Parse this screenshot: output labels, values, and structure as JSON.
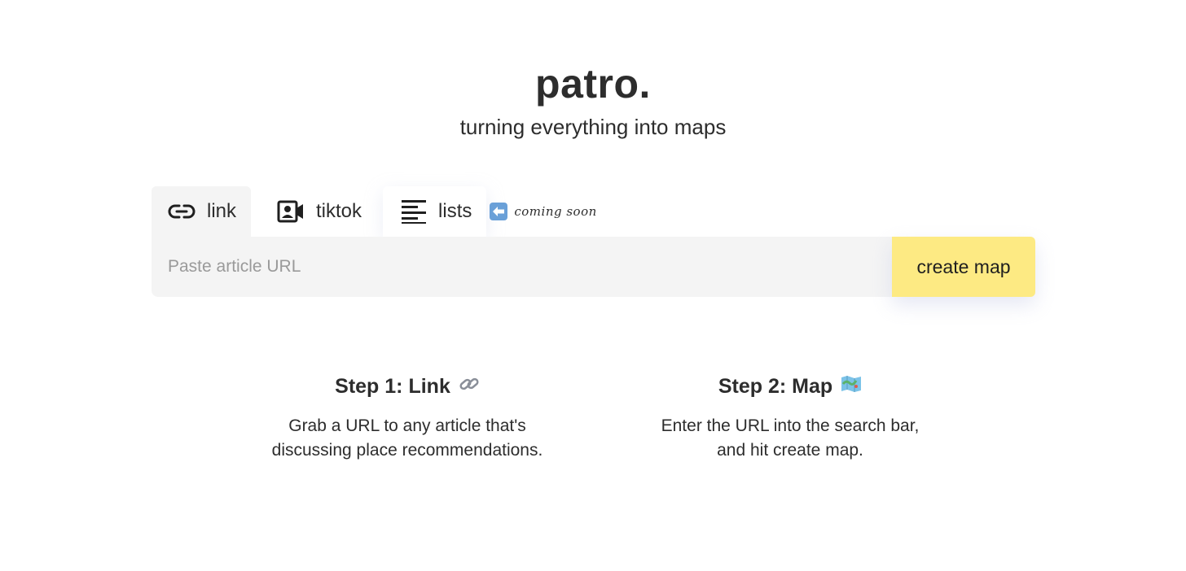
{
  "brand": {
    "logo": "patro.",
    "tagline": "turning everything into maps"
  },
  "tabs": [
    {
      "label": "link",
      "icon": "link-icon",
      "active": true
    },
    {
      "label": "tiktok",
      "icon": "contact-video-icon",
      "active": false
    },
    {
      "label": "lists",
      "icon": "list-lines-icon",
      "active": false
    }
  ],
  "coming_soon": {
    "icon": "left-arrow-icon",
    "text": "coming soon"
  },
  "search": {
    "placeholder": "Paste article URL",
    "value": "",
    "button_label": "create map"
  },
  "steps": [
    {
      "title": "Step 1: Link",
      "icon": "chain-link-icon",
      "desc_line1": "Grab a URL to any article that's",
      "desc_line2": "discussing place recommendations."
    },
    {
      "title": "Step 2: Map",
      "icon": "map-icon",
      "desc_line1": "Enter the URL into the search bar,",
      "desc_line2": "and hit create map."
    }
  ],
  "colors": {
    "accent_yellow": "#fdea83",
    "input_bg": "#f4f4f4",
    "text": "#2d2d2d",
    "arrow_blue": "#6aa0d8"
  }
}
